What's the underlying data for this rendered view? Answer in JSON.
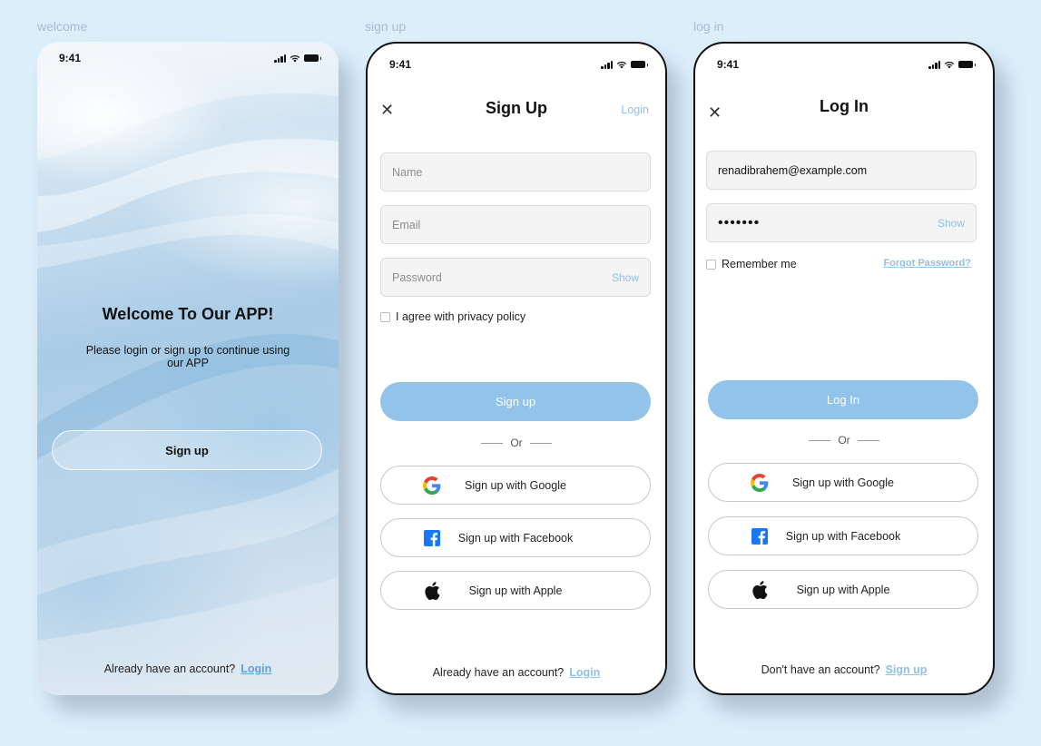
{
  "labels": {
    "welcome": "welcome",
    "signup": "sign up",
    "login": "log in"
  },
  "status": {
    "time": "9:41"
  },
  "welcome": {
    "title": "Welcome To Our APP!",
    "subtitle": "Please login or sign up to continue using our APP",
    "signup_button": "Sign up",
    "footer_text": "Already have an account?",
    "footer_link": "Login"
  },
  "signup": {
    "title": "Sign Up",
    "top_link": "Login",
    "name_placeholder": "Name",
    "email_placeholder": "Email",
    "password_placeholder": "Password",
    "show": "Show",
    "agree": "I agree with privacy policy",
    "submit": "Sign up",
    "or": "Or",
    "google": "Sign up with Google",
    "facebook": "Sign up with Facebook",
    "apple": "Sign up with Apple",
    "footer_text": "Already have an account?",
    "footer_link": "Login"
  },
  "login": {
    "title": "Log In",
    "email_value": "renadibrahem@example.com",
    "password_dots": "•••••••",
    "show": "Show",
    "remember": "Remember me",
    "forgot": "Forgot Password?",
    "submit": "Log In",
    "or": "Or",
    "google": "Sign up with Google",
    "facebook": "Sign up with Facebook",
    "apple": "Sign up with Apple",
    "footer_text": "Don't have an account?",
    "footer_link": "Sign up"
  },
  "icons": {
    "close": "close-icon",
    "google": "google-icon",
    "facebook": "facebook-icon",
    "apple": "apple-icon",
    "signal": "signal-icon",
    "wifi": "wifi-icon",
    "battery": "battery-icon"
  },
  "colors": {
    "background": "#ddeefb",
    "accent": "#92c3ea",
    "link": "#8fc0e6",
    "field_bg": "#f4f4f4"
  }
}
